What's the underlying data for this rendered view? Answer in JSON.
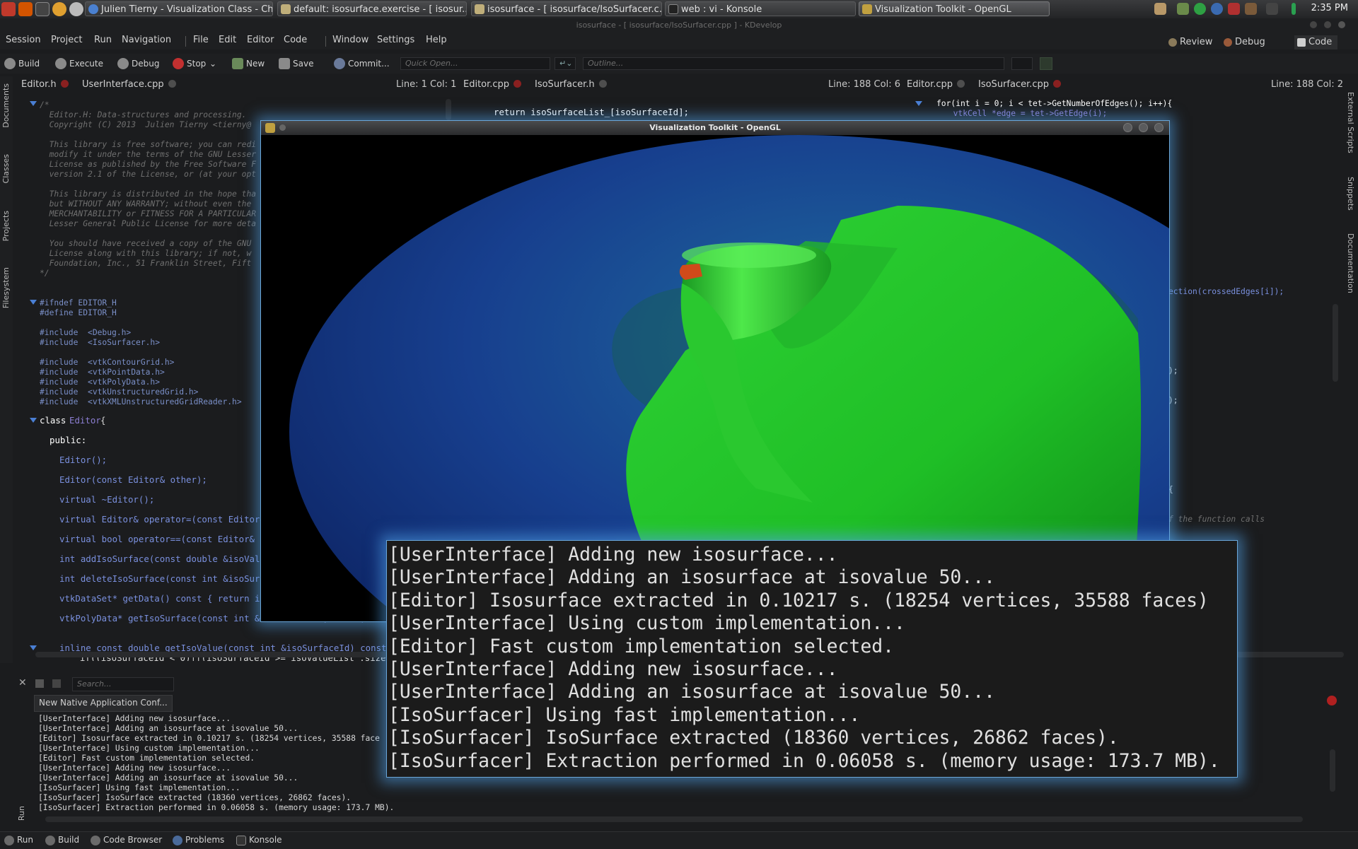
{
  "taskbar": {
    "tabs": [
      {
        "label": "Julien Tierny - Visualization Class - Chr..."
      },
      {
        "label": "default:  isosurface.exercise - [ isosur..."
      },
      {
        "label": "isosurface - [ isosurface/IsoSurfacer.c..."
      },
      {
        "label": "web : vi - Konsole"
      },
      {
        "label": "Visualization Toolkit - OpenGL"
      }
    ],
    "clock": "2:35 PM",
    "colors": {
      "active_tab": "#5a5b5e"
    }
  },
  "kdevelop": {
    "title": "isosurface - [ isosurface/IsoSurfacer.cpp ] - KDevelop",
    "menus": [
      "Session",
      "Project",
      "Run",
      "Navigation",
      "File",
      "Edit",
      "Editor",
      "Code",
      "Window",
      "Settings",
      "Help"
    ],
    "modes": {
      "review": "Review",
      "debug": "Debug",
      "code": "Code"
    },
    "toolbar": {
      "build": "Build",
      "execute": "Execute",
      "debug": "Debug",
      "stop": "Stop",
      "new": "New",
      "save": "Save",
      "commit": "Commit...",
      "quick_open_placeholder": "Quick Open...",
      "outline_placeholder": "Outline..."
    }
  },
  "views": {
    "left": {
      "tabs": [
        "Editor.h",
        "UserInterface.cpp"
      ],
      "linecol": "Line: 1 Col: 1"
    },
    "middle": {
      "tabs": [
        "Editor.cpp",
        "IsoSurfacer.h"
      ],
      "linecol": "Line: 188 Col: 6"
    },
    "right": {
      "tabs": [
        "Editor.cpp",
        "IsoSurfacer.cpp"
      ],
      "linecol": "Line: 188 Col: 2"
    }
  },
  "left_tools": [
    "Documents",
    "Classes",
    "Projects",
    "Filesystem"
  ],
  "right_tools": [
    "External Scripts",
    "Snippets",
    "Documentation"
  ],
  "code_left": [
    "/*",
    "  Editor.H: Data-structures and processing.",
    "  Copyright (C) 2013  Julien Tierny <tierny@",
    "",
    "  This library is free software; you can redi",
    "  modify it under the terms of the GNU Lesser",
    "  License as published by the Free Software F",
    "  version 2.1 of the License, or (at your opt",
    "",
    "  This library is distributed in the hope tha",
    "  but WITHOUT ANY WARRANTY; without even the",
    "  MERCHANTABILITY or FITNESS FOR A PARTICULAR",
    "  Lesser General Public License for more deta",
    "",
    "  You should have received a copy of the GNU",
    "  License along with this library; if not, w",
    "  Foundation, Inc., 51 Franklin Street, Fift",
    "*/",
    "#ifndef EDITOR_H",
    "#define EDITOR_H",
    "#include  <Debug.h>",
    "#include  <IsoSurfacer.h>",
    "#include  <vtkContourGrid.h>",
    "#include  <vtkPointData.h>",
    "#include  <vtkPolyData.h>",
    "#include  <vtkUnstructuredGrid.h>",
    "#include  <vtkXMLUnstructuredGridReader.h>",
    "class ",
    "Editor",
    "{",
    "public:",
    "Editor();",
    "Editor(const Editor& other);",
    "virtual ~Editor();",
    "virtual Editor& operator=(const Editor& o",
    "virtual bool operator==(const Editor& oth",
    "int addIsoSurface(const double &isoValue,",
    "int deleteIsoSurface(const int &isoSurfac",
    "vtkDataSet* getData() const { return inpu",
    "vtkPolyData* getIsoSurface(const int &isoSurfaceId) const;",
    "inline const double getIsoValue(const int &isoSurfaceId) const{",
    "  if((isoSurfaceId < 0)||(isoSurfaceId >= isoValueList_.size()))"
  ],
  "code_middle": {
    "line1": "return isoSurfaceList_[isoSurfaceId];"
  },
  "code_right": [
    "for(int i = 0; i < tet->GetNumberOfEdges(); i++){",
    "  vtkCell *edge = tet->GetEdge(i);",
    "ection(crossedEdges[i]);",
    ");",
    ");",
    "{",
    "f the function calls"
  ],
  "vtk": {
    "title": "Visualization Toolkit - OpenGL",
    "surface_colors": {
      "outer": "#123a9a",
      "inner": "#1fbf26",
      "highlight": "#7aff68"
    }
  },
  "konsole_lines": [
    "[UserInterface] Adding new isosurface...",
    "[UserInterface] Adding an isosurface at isovalue 50...",
    "[Editor] Isosurface extracted in 0.10217 s. (18254 vertices, 35588 faces)",
    "[UserInterface] Using custom implementation...",
    "[Editor] Fast custom implementation selected.",
    "[UserInterface] Adding new isosurface...",
    "[UserInterface] Adding an isosurface at isovalue 50...",
    "[IsoSurfacer] Using fast implementation...",
    "[IsoSurfacer] IsoSurface extracted (18360 vertices, 26862 faces).",
    "[IsoSurfacer] Extraction performed in 0.06058 s. (memory usage: 173.7 MB)."
  ],
  "output": {
    "title": "New Native Application Conf...",
    "search_placeholder": "Search...",
    "side_label": "Run",
    "lines": [
      "[UserInterface] Adding new isosurface...",
      "[UserInterface] Adding an isosurface at isovalue 50...",
      "[Editor] Isosurface extracted in 0.10217 s. (18254 vertices, 35588 face",
      "[UserInterface] Using custom implementation...",
      "[Editor] Fast custom implementation selected.",
      "[UserInterface] Adding new isosurface...",
      "[UserInterface] Adding an isosurface at isovalue 50...",
      "[IsoSurfacer] Using fast implementation...",
      "[IsoSurfacer] IsoSurface extracted (18360 vertices, 26862 faces).",
      "[IsoSurfacer] Extraction performed in 0.06058 s. (memory usage: 173.7 MB)."
    ]
  },
  "statusbar": [
    "Run",
    "Build",
    "Code Browser",
    "Problems",
    "Konsole"
  ]
}
